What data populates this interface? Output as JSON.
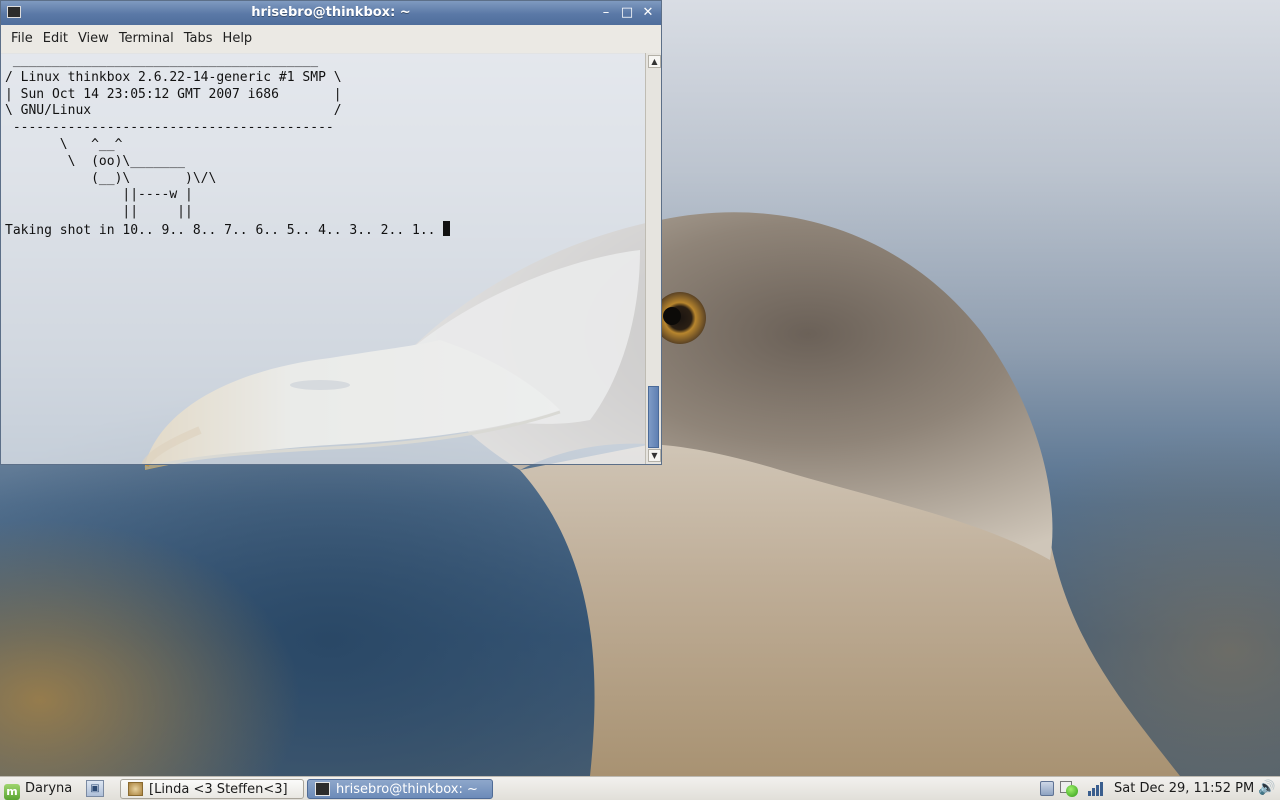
{
  "window": {
    "title": "hrisebro@thinkbox: ~",
    "minimize_glyph": "–",
    "maximize_glyph": "□",
    "close_glyph": "✕"
  },
  "menubar": {
    "items": [
      "File",
      "Edit",
      "View",
      "Terminal",
      "Tabs",
      "Help"
    ]
  },
  "terminal": {
    "lines": [
      " _______________________________________",
      "/ Linux thinkbox 2.6.22-14-generic #1 SMP \\",
      "| Sun Oct 14 23:05:12 GMT 2007 i686       |",
      "\\ GNU/Linux                               /",
      " -----------------------------------------",
      "       \\   ^__^",
      "        \\  (oo)\\_______",
      "           (__)\\       )\\/\\",
      "               ||----w |",
      "               ||     ||",
      "Taking shot in 10.. 9.. 8.. 7.. 6.. 5.. 4.. 3.. 2.. 1.. "
    ]
  },
  "taskbar": {
    "start_label": "Daryna",
    "tasks": [
      {
        "label": "[Linda <3  Steffen<3]",
        "icon": "image-viewer-icon",
        "active": false
      },
      {
        "label": "hrisebro@thinkbox: ~",
        "icon": "terminal-icon",
        "active": true
      }
    ],
    "clock": "Sat Dec 29, 11:52 PM",
    "tray_icons": [
      "clipboard-icon",
      "network-status-icon",
      "signal-bars-icon",
      "volume-icon"
    ]
  },
  "colors": {
    "titlebar": "#5a78a6",
    "taskbar_active": "#6c8bb9",
    "menubar": "#ebe9e4"
  }
}
